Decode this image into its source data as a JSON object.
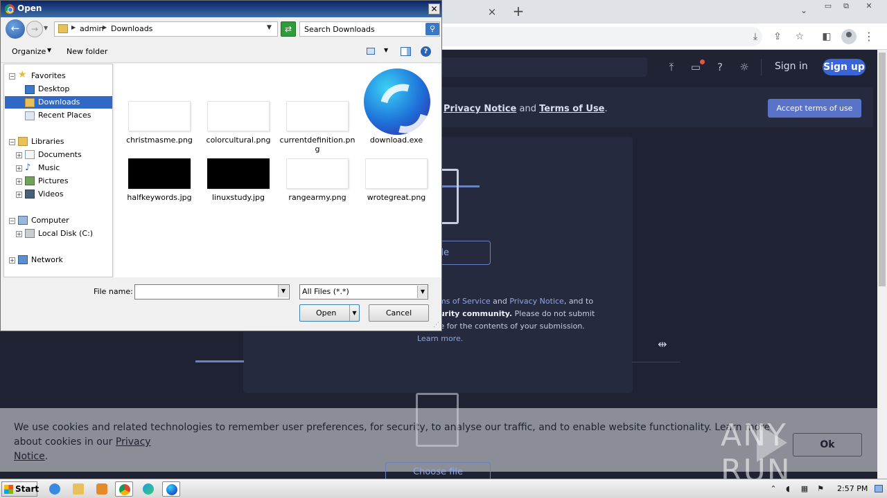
{
  "browser": {
    "tab_close_icon": "×",
    "new_tab_icon": "+",
    "tab_search_icon": "⌄",
    "window_controls": [
      "▭",
      "⧉",
      "✕"
    ],
    "toolbar_icons": [
      "download-icon",
      "share-icon",
      "star-icon",
      "sidepanel-icon",
      "profile-icon",
      "menu-icon"
    ]
  },
  "site": {
    "sign_in": "Sign in",
    "sign_up": "Sign up",
    "terms_banner": {
      "link_privacy": "Privacy Notice",
      "and": " and ",
      "link_terms": "Terms of Use",
      "end": ".",
      "accept_button": "Accept terms of use"
    },
    "choose_file_top": "e file",
    "choose_file_bottom": "Choose file",
    "disclaimer": {
      "l1_pre": "ur ",
      "l1_tos": "Terms of Service",
      "l1_and": " and ",
      "l1_pn": "Privacy Notice",
      "l1_end": ", and to",
      "l2_bold": "e security community.",
      "l2_rest": " Please do not submit",
      "l3": "onsible for the contents of your submission.",
      "l4_link": "Learn more."
    },
    "cookie": {
      "text": "We use cookies and related technologies to remember user preferences, for security, to analyse our traffic, and to enable website functionality. Learn more about cookies in our ",
      "link_1": "Privacy",
      "link_2": "Notice",
      "end": ".",
      "ok_button": "Ok"
    },
    "watermark": "ANY RUN"
  },
  "dialog": {
    "title": "Open",
    "close": "✕",
    "address": {
      "segments": [
        "admin",
        "Downloads"
      ]
    },
    "search_placeholder": "Search Downloads",
    "toolbar": {
      "organize": "Organize",
      "new_folder": "New folder",
      "help": "?"
    },
    "tree": [
      {
        "label": "Favorites",
        "icon": "star-icon"
      },
      {
        "label": "Desktop",
        "icon": "desktop-icon"
      },
      {
        "label": "Downloads",
        "icon": "downloads-folder-icon",
        "selected": true
      },
      {
        "label": "Recent Places",
        "icon": "recent-places-icon"
      },
      {
        "label": "Libraries",
        "icon": "libraries-icon"
      },
      {
        "label": "Documents",
        "icon": "documents-icon"
      },
      {
        "label": "Music",
        "icon": "music-icon"
      },
      {
        "label": "Pictures",
        "icon": "pictures-icon"
      },
      {
        "label": "Videos",
        "icon": "videos-icon"
      },
      {
        "label": "Computer",
        "icon": "computer-icon"
      },
      {
        "label": "Local Disk (C:)",
        "icon": "disk-icon"
      },
      {
        "label": "Network",
        "icon": "network-icon"
      }
    ],
    "files": [
      {
        "name": "christmasme.png",
        "thumb": "white"
      },
      {
        "name": "colorcultural.png",
        "thumb": "white"
      },
      {
        "name": "currentdefinition.png",
        "thumb": "white"
      },
      {
        "name": "download.exe",
        "thumb": "app-icon"
      },
      {
        "name": "halfkeywords.jpg",
        "thumb": "black"
      },
      {
        "name": "linuxstudy.jpg",
        "thumb": "black"
      },
      {
        "name": "rangearmy.png",
        "thumb": "white"
      },
      {
        "name": "wrotegreat.png",
        "thumb": "white"
      }
    ],
    "file_name_label": "File name:",
    "file_name_value": "",
    "filter": "All Files (*.*)",
    "open_button": "Open",
    "cancel_button": "Cancel"
  },
  "taskbar": {
    "start": "Start",
    "apps": [
      "internet-explorer-icon",
      "explorer-icon",
      "media-player-icon",
      "chrome-icon",
      "edge-icon",
      "app-icon"
    ],
    "clock": "2:57 PM"
  },
  "colors": {
    "dialog_title": "#0a246a",
    "selection": "#3168c6",
    "page_bg": "#1f2233",
    "accent": "#3b64d6"
  }
}
